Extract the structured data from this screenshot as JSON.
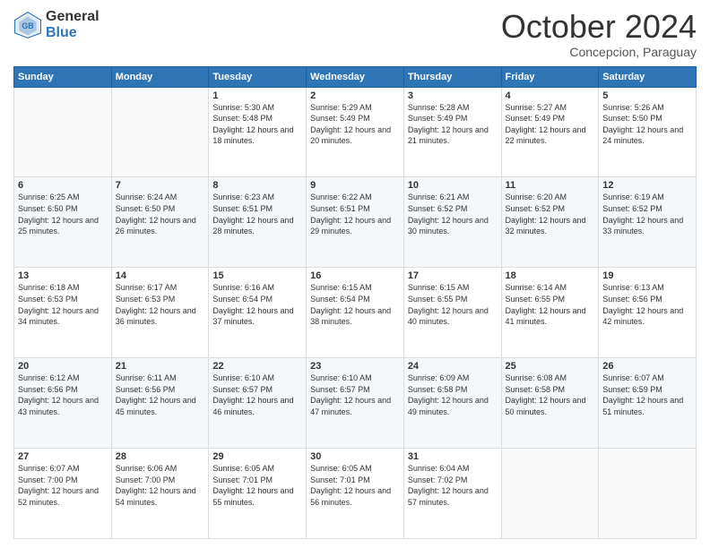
{
  "header": {
    "logo_line1": "General",
    "logo_line2": "Blue",
    "month": "October 2024",
    "location": "Concepcion, Paraguay"
  },
  "days_of_week": [
    "Sunday",
    "Monday",
    "Tuesday",
    "Wednesday",
    "Thursday",
    "Friday",
    "Saturday"
  ],
  "weeks": [
    [
      {
        "day": "",
        "info": ""
      },
      {
        "day": "",
        "info": ""
      },
      {
        "day": "1",
        "info": "Sunrise: 5:30 AM\nSunset: 5:48 PM\nDaylight: 12 hours and 18 minutes."
      },
      {
        "day": "2",
        "info": "Sunrise: 5:29 AM\nSunset: 5:49 PM\nDaylight: 12 hours and 20 minutes."
      },
      {
        "day": "3",
        "info": "Sunrise: 5:28 AM\nSunset: 5:49 PM\nDaylight: 12 hours and 21 minutes."
      },
      {
        "day": "4",
        "info": "Sunrise: 5:27 AM\nSunset: 5:49 PM\nDaylight: 12 hours and 22 minutes."
      },
      {
        "day": "5",
        "info": "Sunrise: 5:26 AM\nSunset: 5:50 PM\nDaylight: 12 hours and 24 minutes."
      }
    ],
    [
      {
        "day": "6",
        "info": "Sunrise: 6:25 AM\nSunset: 6:50 PM\nDaylight: 12 hours and 25 minutes."
      },
      {
        "day": "7",
        "info": "Sunrise: 6:24 AM\nSunset: 6:50 PM\nDaylight: 12 hours and 26 minutes."
      },
      {
        "day": "8",
        "info": "Sunrise: 6:23 AM\nSunset: 6:51 PM\nDaylight: 12 hours and 28 minutes."
      },
      {
        "day": "9",
        "info": "Sunrise: 6:22 AM\nSunset: 6:51 PM\nDaylight: 12 hours and 29 minutes."
      },
      {
        "day": "10",
        "info": "Sunrise: 6:21 AM\nSunset: 6:52 PM\nDaylight: 12 hours and 30 minutes."
      },
      {
        "day": "11",
        "info": "Sunrise: 6:20 AM\nSunset: 6:52 PM\nDaylight: 12 hours and 32 minutes."
      },
      {
        "day": "12",
        "info": "Sunrise: 6:19 AM\nSunset: 6:52 PM\nDaylight: 12 hours and 33 minutes."
      }
    ],
    [
      {
        "day": "13",
        "info": "Sunrise: 6:18 AM\nSunset: 6:53 PM\nDaylight: 12 hours and 34 minutes."
      },
      {
        "day": "14",
        "info": "Sunrise: 6:17 AM\nSunset: 6:53 PM\nDaylight: 12 hours and 36 minutes."
      },
      {
        "day": "15",
        "info": "Sunrise: 6:16 AM\nSunset: 6:54 PM\nDaylight: 12 hours and 37 minutes."
      },
      {
        "day": "16",
        "info": "Sunrise: 6:15 AM\nSunset: 6:54 PM\nDaylight: 12 hours and 38 minutes."
      },
      {
        "day": "17",
        "info": "Sunrise: 6:15 AM\nSunset: 6:55 PM\nDaylight: 12 hours and 40 minutes."
      },
      {
        "day": "18",
        "info": "Sunrise: 6:14 AM\nSunset: 6:55 PM\nDaylight: 12 hours and 41 minutes."
      },
      {
        "day": "19",
        "info": "Sunrise: 6:13 AM\nSunset: 6:56 PM\nDaylight: 12 hours and 42 minutes."
      }
    ],
    [
      {
        "day": "20",
        "info": "Sunrise: 6:12 AM\nSunset: 6:56 PM\nDaylight: 12 hours and 43 minutes."
      },
      {
        "day": "21",
        "info": "Sunrise: 6:11 AM\nSunset: 6:56 PM\nDaylight: 12 hours and 45 minutes."
      },
      {
        "day": "22",
        "info": "Sunrise: 6:10 AM\nSunset: 6:57 PM\nDaylight: 12 hours and 46 minutes."
      },
      {
        "day": "23",
        "info": "Sunrise: 6:10 AM\nSunset: 6:57 PM\nDaylight: 12 hours and 47 minutes."
      },
      {
        "day": "24",
        "info": "Sunrise: 6:09 AM\nSunset: 6:58 PM\nDaylight: 12 hours and 49 minutes."
      },
      {
        "day": "25",
        "info": "Sunrise: 6:08 AM\nSunset: 6:58 PM\nDaylight: 12 hours and 50 minutes."
      },
      {
        "day": "26",
        "info": "Sunrise: 6:07 AM\nSunset: 6:59 PM\nDaylight: 12 hours and 51 minutes."
      }
    ],
    [
      {
        "day": "27",
        "info": "Sunrise: 6:07 AM\nSunset: 7:00 PM\nDaylight: 12 hours and 52 minutes."
      },
      {
        "day": "28",
        "info": "Sunrise: 6:06 AM\nSunset: 7:00 PM\nDaylight: 12 hours and 54 minutes."
      },
      {
        "day": "29",
        "info": "Sunrise: 6:05 AM\nSunset: 7:01 PM\nDaylight: 12 hours and 55 minutes."
      },
      {
        "day": "30",
        "info": "Sunrise: 6:05 AM\nSunset: 7:01 PM\nDaylight: 12 hours and 56 minutes."
      },
      {
        "day": "31",
        "info": "Sunrise: 6:04 AM\nSunset: 7:02 PM\nDaylight: 12 hours and 57 minutes."
      },
      {
        "day": "",
        "info": ""
      },
      {
        "day": "",
        "info": ""
      }
    ]
  ]
}
